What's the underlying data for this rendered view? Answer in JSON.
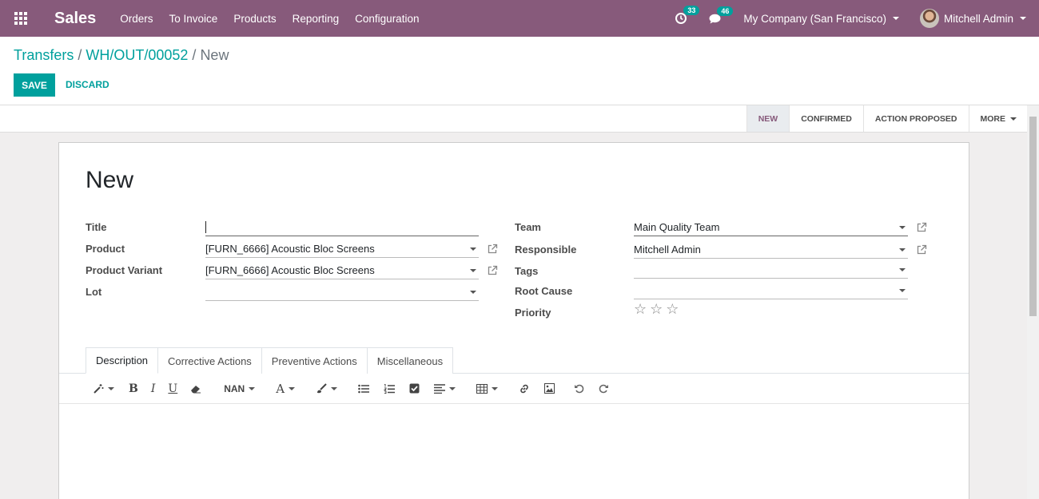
{
  "nav": {
    "brand": "Sales",
    "menu": [
      "Orders",
      "To Invoice",
      "Products",
      "Reporting",
      "Configuration"
    ],
    "activity_count": "33",
    "message_count": "46",
    "company": "My Company (San Francisco)",
    "user": "Mitchell Admin"
  },
  "breadcrumb": {
    "parent": "Transfers",
    "record": "WH/OUT/00052",
    "current": "New"
  },
  "buttons": {
    "save": "Save",
    "discard": "DISCARD"
  },
  "statusbar": {
    "stages": [
      "NEW",
      "CONFIRMED",
      "ACTION PROPOSED"
    ],
    "active_stage": "NEW",
    "more": "MORE"
  },
  "form": {
    "title": "New",
    "left": {
      "title_label": "Title",
      "title_value": "",
      "product_label": "Product",
      "product_value": "[FURN_6666] Acoustic Bloc Screens",
      "variant_label": "Product Variant",
      "variant_value": "[FURN_6666] Acoustic Bloc Screens",
      "lot_label": "Lot",
      "lot_value": ""
    },
    "right": {
      "team_label": "Team",
      "team_value": "Main Quality Team",
      "responsible_label": "Responsible",
      "responsible_value": "Mitchell Admin",
      "tags_label": "Tags",
      "tags_value": "",
      "root_cause_label": "Root Cause",
      "root_cause_value": "",
      "priority_label": "Priority",
      "priority_stars": 0
    }
  },
  "tabs": [
    "Description",
    "Corrective Actions",
    "Preventive Actions",
    "Miscellaneous"
  ],
  "toolbar": {
    "font_size": "NAN",
    "icons": [
      "magic-wand-icon",
      "bold-icon",
      "italic-icon",
      "underline-icon",
      "eraser-icon",
      "font-size-dropdown",
      "font-color-icon",
      "brush-icon",
      "bullet-list-icon",
      "numbered-list-icon",
      "checklist-icon",
      "align-icon",
      "table-icon",
      "link-icon",
      "image-icon",
      "undo-icon",
      "redo-icon"
    ]
  },
  "colors": {
    "brand": "#875a7b",
    "accent": "#00a09d"
  }
}
